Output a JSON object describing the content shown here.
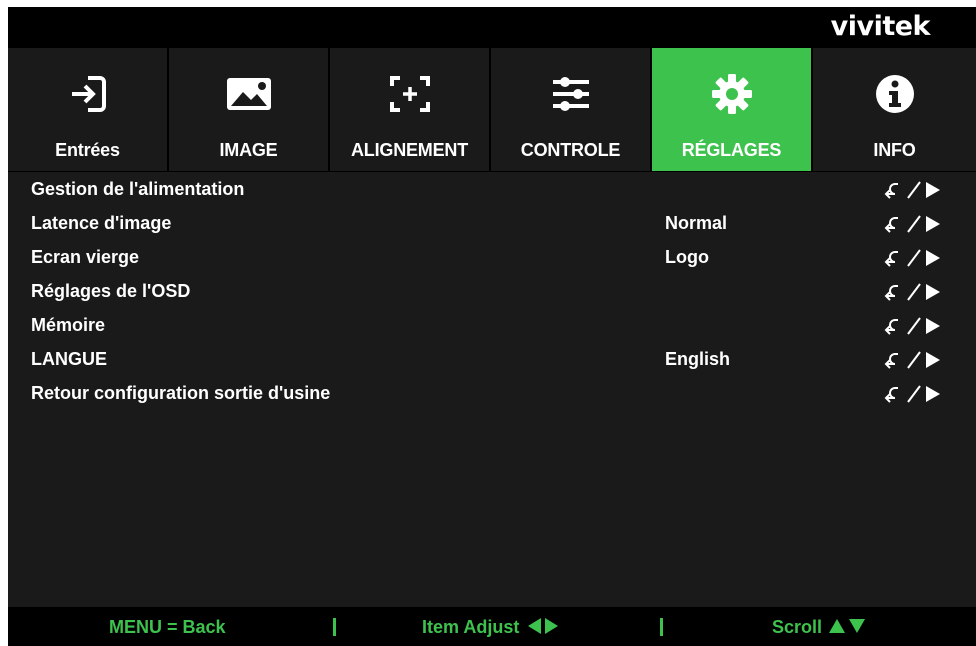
{
  "brand": "vivitek",
  "colors": {
    "accent": "#3ec24e",
    "tab_bg": "#1a1a1a",
    "panel_bg": "#1a1a1a",
    "text": "#ffffff"
  },
  "tabs": [
    {
      "label": "Entrées",
      "icon": "input-icon",
      "active": false
    },
    {
      "label": "IMAGE",
      "icon": "image-icon",
      "active": false
    },
    {
      "label": "ALIGNEMENT",
      "icon": "alignment-icon",
      "active": false
    },
    {
      "label": "CONTROLE",
      "icon": "sliders-icon",
      "active": false
    },
    {
      "label": "RÉGLAGES",
      "icon": "gear-icon",
      "active": true
    },
    {
      "label": "INFO",
      "icon": "info-icon",
      "active": false
    }
  ],
  "menu": [
    {
      "label": "Gestion de l'alimentation",
      "value": ""
    },
    {
      "label": "Latence d'image",
      "value": "Normal"
    },
    {
      "label": "Ecran vierge",
      "value": "Logo"
    },
    {
      "label": "Réglages de l'OSD",
      "value": ""
    },
    {
      "label": "Mémoire",
      "value": ""
    },
    {
      "label": "LANGUE",
      "value": "English"
    },
    {
      "label": "Retour configuration sortie d'usine",
      "value": ""
    }
  ],
  "row_action_icon": "enter-or-right-arrow-icon",
  "footer": {
    "back": "MENU = Back",
    "adjust": "Item Adjust",
    "scroll": "Scroll"
  }
}
